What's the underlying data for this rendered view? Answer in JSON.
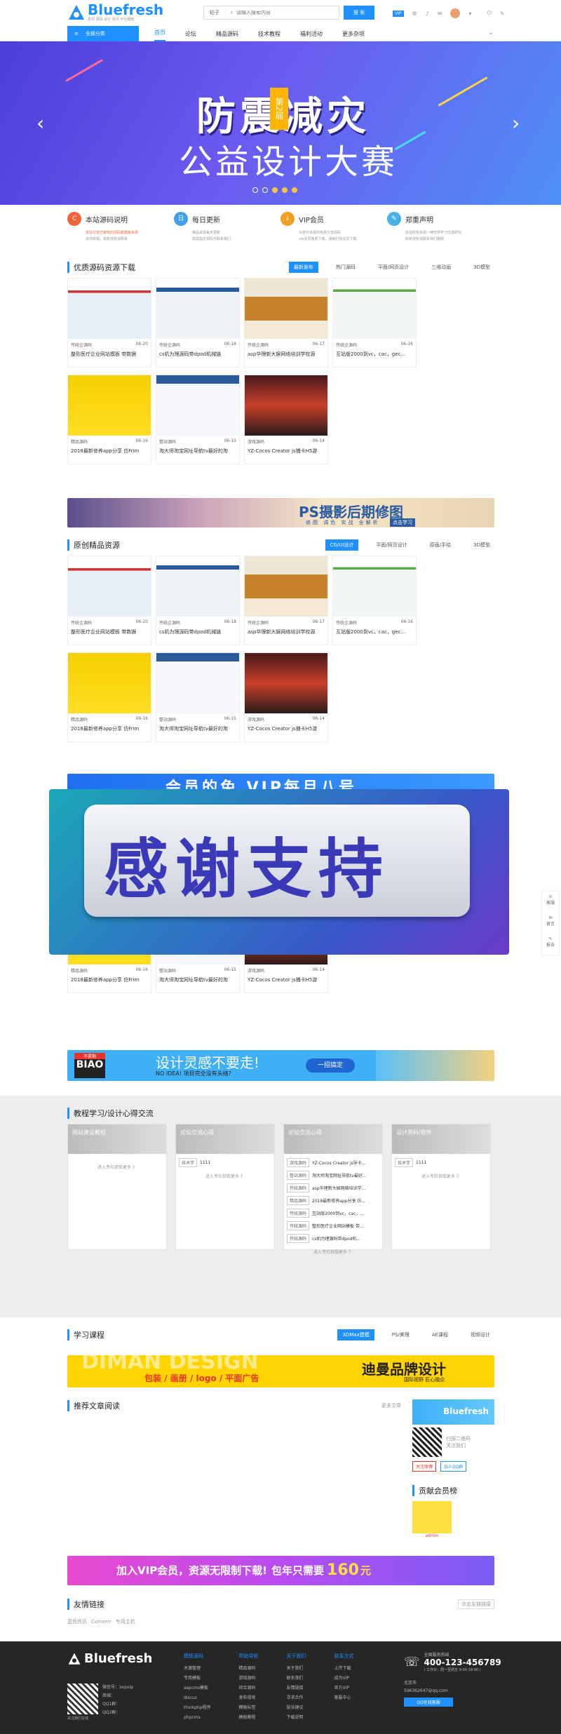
{
  "header": {
    "logo": "Bluefresh",
    "logo_sub": "素材 源码 设计 资讯 平台模板",
    "search_prefix": "帖子",
    "search_placeholder": "请输入搜索内容",
    "search_btn": "搜 索",
    "vip": "VIP"
  },
  "nav": {
    "category": "全部分类",
    "items": [
      "首页",
      "论坛",
      "精品源码",
      "技术教程",
      "福利活动",
      "更多杂项"
    ]
  },
  "hero": {
    "tag": "第2届",
    "title": "防震减灾",
    "subtitle": "公益设计大赛"
  },
  "features": [
    {
      "title": "本站源码说明",
      "desc1": "本站分享已审核的源码和模板资源",
      "desc2": "请勿转载，如有侵权请联系",
      "icon": "C",
      "color": "#f0643c"
    },
    {
      "title": "每日更新",
      "desc1": "精品资源每天更新",
      "desc2": "如需指定源码可联系我们",
      "icon": "日",
      "color": "#3fa0f0"
    },
    {
      "title": "VIP会员",
      "desc1": "大部分资源均免费分享源码",
      "desc2": "vip会员免费下载，成就打造会员下载",
      "icon": "↓",
      "color": "#f0a020"
    },
    {
      "title": "郑重声明",
      "desc1": "本站所有资源一律仅供学习交流研究",
      "desc2": "如有侵权请联系我们删除",
      "icon": "✎",
      "color": "#4ab0e8"
    }
  ],
  "sec1": {
    "title": "优质源码资源下载",
    "tabs": [
      "最新发布",
      "热门源码",
      "平面/网页设计",
      "三维动画",
      "3D模型"
    ]
  },
  "sec2": {
    "title": "原创精品资源",
    "tabs": [
      "CG/UI设计",
      "平面/网页设计",
      "原画/手绘",
      "3D模型"
    ]
  },
  "cards": [
    {
      "cat": "传统企源码",
      "date": "06-20",
      "name": "整形医疗企业网站模板 带数据"
    },
    {
      "cat": "传统企源码",
      "date": "06-18",
      "name": "cs机为理源码带dpod机械链"
    },
    {
      "cat": "传统企源码",
      "date": "06-17",
      "name": "asp华理新大娱网络培训学校源"
    },
    {
      "cat": "传统企源码",
      "date": "06-16",
      "name": "互站版2000到vc，cac，gec..."
    },
    {
      "cat": "精品源码",
      "date": "06-16",
      "name": "2018最新修养app分享 仿Frim"
    },
    {
      "cat": "整站源码",
      "date": "06-15",
      "name": "淘大师淘宝网址导航tv最好的淘"
    },
    {
      "cat": "游戏源码",
      "date": "06-14",
      "name": "YZ-Cocos Creator js捕卡H5游"
    }
  ],
  "ps_banner": {
    "title": "PS摄影后期修图",
    "sub": "修图 调色 实战 全解析",
    "btn": "点击学习"
  },
  "vip_banner": {
    "text": "会员的免 VIP每月八号"
  },
  "overlay": {
    "text": "感谢支持"
  },
  "idea_banner": {
    "logo": "BIAO",
    "badge": "不要剩",
    "title": "设计灵感不要走!",
    "sub": "NO IDEA! 项目完全没有头绪?",
    "btn": "一招搞定"
  },
  "forum": {
    "title": "教程学习/设计心得交流",
    "boards": [
      {
        "head": "网站建设教程",
        "more": "进入专栏获取更多 》",
        "items": []
      },
      {
        "head": "论坛交流心得",
        "more": "进入专栏获取更多 》",
        "items": [
          {
            "tag": "技术学",
            "text": "1111"
          }
        ]
      },
      {
        "head": "论坛交流心得",
        "more": "进入专栏获取更多 》",
        "items": [
          {
            "tag": "游戏源码",
            "text": "YZ-Cocos Creator js导卡..."
          },
          {
            "tag": "整站源码",
            "text": "淘大师淘宝网址导航tv最好..."
          },
          {
            "tag": "传统源码",
            "text": "asp华理新大娱网络培训学..."
          },
          {
            "tag": "精品源码",
            "text": "2018最新修养app分享 仿..."
          },
          {
            "tag": "传统源码",
            "text": "互站版2000到vc，cac，..."
          },
          {
            "tag": "传统源码",
            "text": "整形医疗企业网站模板 带..."
          },
          {
            "tag": "传统源码",
            "text": "cs机为理源码带dpod机..."
          }
        ]
      },
      {
        "head": "设计资料/软件",
        "more": "进入专栏获取更多 》",
        "items": [
          {
            "tag": "技术学",
            "text": "1111"
          }
        ]
      }
    ]
  },
  "learn": {
    "title": "学习课程",
    "tabs": [
      "3DMax建模",
      "PS/美理",
      "AE课程",
      "视频设计"
    ]
  },
  "diman": {
    "bg": "DIMAN DESIGN",
    "title": "迪曼品牌设计",
    "sub": "国际视野 匠心独企",
    "cats": "包装 / 画册 / logo / 平面广告"
  },
  "articles": {
    "title": "推荐文章阅读",
    "more": "更多文章"
  },
  "sidebar": {
    "logo": "Bluefresh",
    "qr_text1": "扫描二维码",
    "qr_text2": "关注我们",
    "btn1": "关注微博",
    "btn2": "加入QQ群",
    "member_title": "贡献会员榜",
    "member_name": "admin"
  },
  "vip_promo": {
    "a": "加入VIP会员，资源无限制下载!",
    "b": "包年只需要",
    "price": "160",
    "unit": "元"
  },
  "links": {
    "title": "友情链接",
    "apply": "点击友链链接",
    "items": [
      "蓝色资讯",
      "Comerrr",
      "专用主机"
    ]
  },
  "right_tools": [
    "客服",
    "留言",
    "报告"
  ],
  "footer": {
    "logo": "Bluefresh",
    "cols": [
      {
        "title": "模板源码",
        "items": [
          "木源管理",
          "专用模板",
          "aspcms模板",
          "discuz",
          "thinkphp程序",
          "phpcms"
        ]
      },
      {
        "title": "帮助导航",
        "items": [
          "精品源码",
          "游戏源码",
          "综合源码",
          "发布规则",
          "模板标签",
          "模板教程"
        ]
      },
      {
        "title": "关于我们",
        "items": [
          "关于我们",
          "联系我们",
          "友情链接",
          "寻求合作",
          "投诉建议",
          "下载说明"
        ]
      },
      {
        "title": "联系方式",
        "items": [
          "上传下载",
          "成为VIP",
          "官方VIP",
          "客服中心"
        ]
      }
    ],
    "contact_label": "全国服务热线",
    "phone": "400-123-456789",
    "hours": "( 工作日：周一至周五 9:00-18:00 )",
    "addr": "北京市",
    "email": "596362647@qq.com",
    "qq_btn": "QQ在线客服",
    "info": [
      "微信号：xxpxip",
      "商城：",
      "QQ1群：",
      "QQ2群："
    ],
    "qr_caption": "关注我们在线"
  }
}
